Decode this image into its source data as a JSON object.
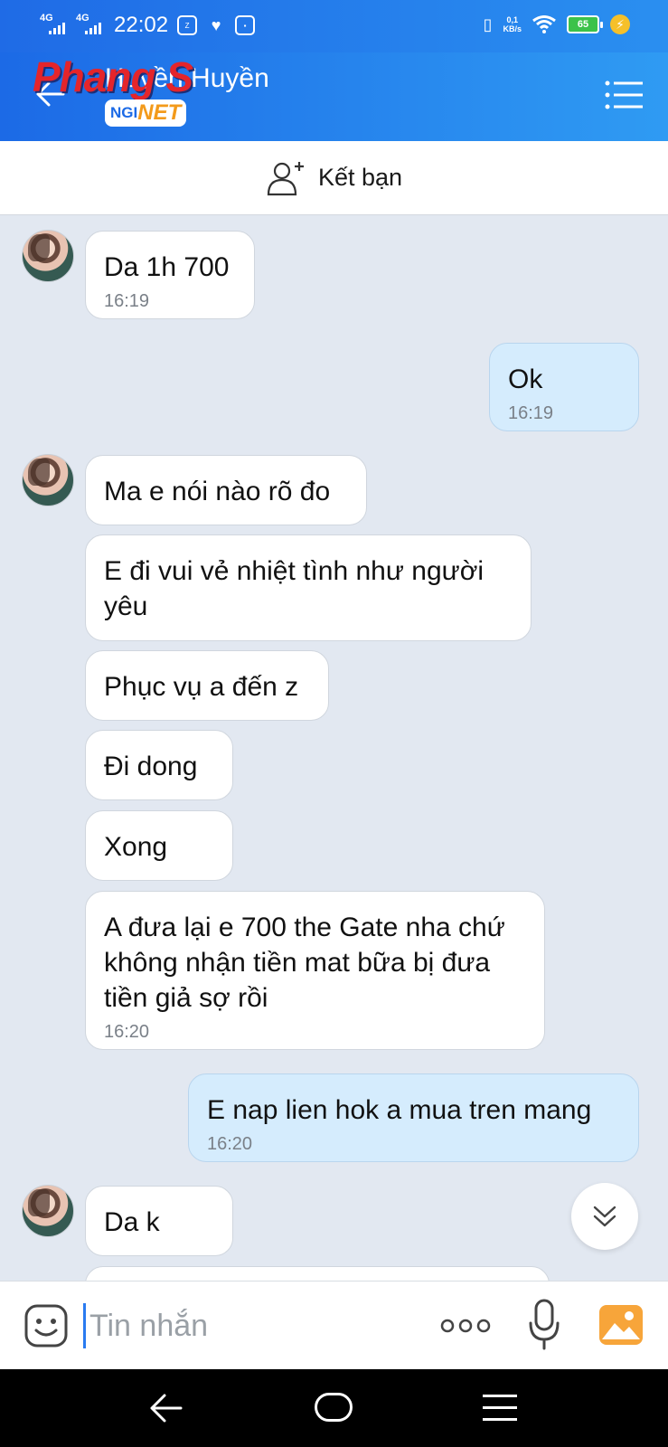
{
  "status_bar": {
    "signal1": "4G",
    "signal2": "4G",
    "time": "22:02",
    "net_speed_value": "0,1",
    "net_speed_unit": "KB/s",
    "battery_level": "65"
  },
  "header": {
    "contact_name": "Huyền Huyền",
    "watermark_logo": "Phang S",
    "watermark_badge_a": "NGI",
    "watermark_badge_b": "NET"
  },
  "friend_bar": {
    "label": "Kết bạn"
  },
  "messages": [
    {
      "dir": "in",
      "text": "Da 1h 700",
      "time": "16:19"
    },
    {
      "dir": "out",
      "text": "Ok",
      "time": "16:19"
    },
    {
      "dir": "in",
      "text": "Ma e nói nào rõ đo",
      "time": ""
    },
    {
      "dir": "in",
      "text": "E đi vui vẻ nhiệt tình như người yêu",
      "time": ""
    },
    {
      "dir": "in",
      "text": "Phục vụ a đến z",
      "time": ""
    },
    {
      "dir": "in",
      "text": "Đi dong",
      "time": ""
    },
    {
      "dir": "in",
      "text": "Xong",
      "time": ""
    },
    {
      "dir": "in",
      "text": "A đưa lại e 700 the Gate nha chứ không nhận tiền mat bữa bị đưa tiền giả sợ rồi",
      "time": "16:20"
    },
    {
      "dir": "out",
      "text": "E nap lien hok a mua tren mang",
      "time": "16:20"
    },
    {
      "dir": "in",
      "text": "Da k",
      "time": ""
    }
  ],
  "input": {
    "placeholder": "Tin nhắn"
  },
  "colors": {
    "header_blue": "#1f6be6",
    "outgoing_bubble": "#d5ecfd",
    "chat_bg": "#e2e8f1"
  }
}
